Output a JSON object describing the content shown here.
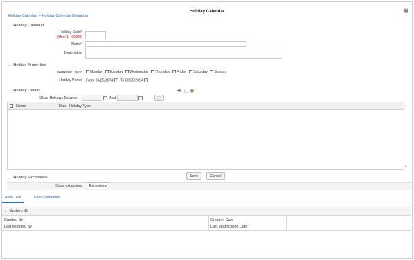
{
  "header": {
    "breadcrumb": "Holiday Calendar > Holiday Calendar Definition",
    "title": "Holiday Calendar",
    "help_icon": "?"
  },
  "holiday_calendar": {
    "section_title": "Holiday Calendar",
    "code_label": "Holiday Code",
    "code_required": "*",
    "code_hint": "(Hint: 1 - 99999)",
    "code_value": "",
    "name_label": "Name",
    "name_required": "*",
    "name_value": "",
    "description_label": "Description",
    "description_value": ""
  },
  "holiday_properties": {
    "section_title": "Holiday Properties",
    "weekend_label": "Weekend Days",
    "weekend_required": "*",
    "days": [
      "Monday",
      "Tuesday",
      "Wednesday",
      "Thursday",
      "Friday",
      "Saturday",
      "Sunday"
    ],
    "period_label": "Holiday Period",
    "from_label": "From",
    "from_value": "06/25/1974",
    "to_label": "To",
    "to_value": "06/25/2054"
  },
  "holiday_details": {
    "section_title": "Holiday Details",
    "show_between_label": "Show Holidays Between",
    "and_label": "And",
    "columns": [
      "Name",
      "Date",
      "Holiday Type"
    ]
  },
  "actions": {
    "save_label": "Save",
    "cancel_label": "Cancel"
  },
  "holiday_exceptions": {
    "section_title": "Holiday Exceptions",
    "show_label": "Show exceptions",
    "exceptions_button": "Exceptions"
  },
  "tabs": [
    "Audit Trail",
    "User Comments"
  ],
  "audit": {
    "system_id_label": "System ID:",
    "created_by_label": "Created By",
    "creation_date_label": "Creation Date",
    "last_modified_by_label": "Last Modified By",
    "last_modification_date_label": "Last Modification Date"
  }
}
